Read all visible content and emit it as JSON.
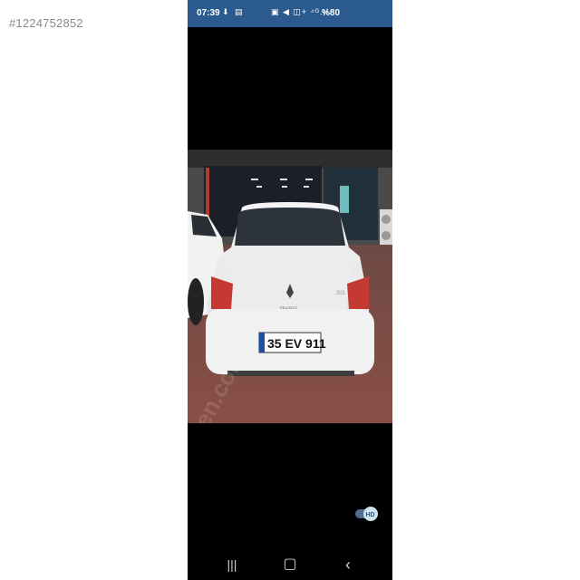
{
  "listing": {
    "id_label": "#1224752852"
  },
  "status_bar": {
    "time": "07:39",
    "left_icons": "⬇ ▤",
    "right_icons": "▣ ◀ ◫+ ⁴ᴳ.ıl",
    "battery": "%80",
    "bg_color": "#2b5a8f"
  },
  "photo": {
    "license_plate": "35 EV 911",
    "brand_text": "PEUGEOT",
    "trim_badge": "301",
    "watermark": "sahibinden.com"
  },
  "controls": {
    "hd_label": "HD",
    "nav": {
      "recents_icon": "recents-icon",
      "home_icon": "home-icon",
      "back_icon": "back-icon"
    },
    "recents_glyph": "|||",
    "home_glyph": "▢",
    "back_glyph": "‹"
  }
}
